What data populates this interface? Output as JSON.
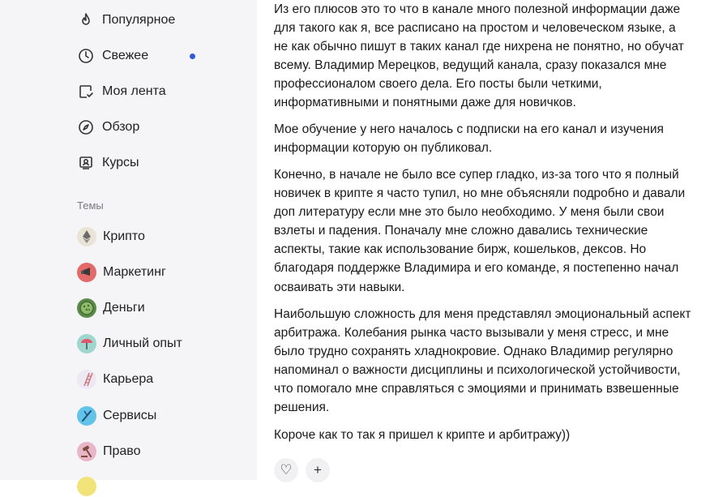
{
  "sidebar": {
    "nav": [
      {
        "label": "Популярное",
        "icon": "flame-icon"
      },
      {
        "label": "Свежее",
        "icon": "clock-icon",
        "has_new_indicator": true
      },
      {
        "label": "Моя лента",
        "icon": "feed-icon"
      },
      {
        "label": "Обзор",
        "icon": "compass-icon"
      },
      {
        "label": "Курсы",
        "icon": "courses-icon"
      }
    ],
    "topics_title": "Темы",
    "topics": [
      {
        "label": "Крипто",
        "icon": "crypto-icon",
        "color": "#e9e4d6"
      },
      {
        "label": "Маркетинг",
        "icon": "marketing-icon",
        "color": "#e46a6a"
      },
      {
        "label": "Деньги",
        "icon": "money-icon",
        "color": "#5b8a4b"
      },
      {
        "label": "Личный опыт",
        "icon": "personal-experience-icon",
        "color": "#9fd6cf"
      },
      {
        "label": "Карьера",
        "icon": "career-icon",
        "color": "#ede8f3"
      },
      {
        "label": "Сервисы",
        "icon": "services-icon",
        "color": "#62c2e8"
      },
      {
        "label": "Право",
        "icon": "law-icon",
        "color": "#e8b6c6"
      }
    ],
    "accent_color": "#2f5bd7"
  },
  "article": {
    "paragraphs": [
      "Из его плюсов это то что в канале много полезной информации даже для такого как я, все расписано на простом и человеческом языке, а не как обычно пишут в таких канал где нихрена не понятно, но обучат всему. Владимир Мерецков, ведущий канала, сразу показался мне профессионалом своего дела. Его посты были четкими, информативными и понятными даже для новичков.",
      "Мое обучение у него началось с подписки на его канал и изучения информации которую он публиковал.",
      "Конечно, в начале не было все супер гладко, из-за того что я полный новичек в крипте я часто тупил, но мне объясняли подробно и давали доп литературу если мне это было необходимо. У меня были свои взлеты и падения. Поначалу мне сложно давались технические аспекты, такие как использование бирж, кошельков, дексов. Но благодаря поддержке Владимира и его команде, я постепенно начал осваивать эти навыки.",
      "Наибольшую сложность для меня представлял эмоциональный аспект арбитража. Колебания рынка часто вызывали у меня стресс, и мне было трудно сохранять хладнокровие. Однако Владимир регулярно напоминал о важности дисциплины и психологической устойчивости, что помогало мне справляться с эмоциями и принимать взвешенные решения.",
      "Короче как то так я пришел к крипте и арбитражу))"
    ],
    "actions": [
      {
        "icon": "heart-icon",
        "glyph": "♡"
      },
      {
        "icon": "plus-icon",
        "glyph": "+"
      }
    ]
  }
}
